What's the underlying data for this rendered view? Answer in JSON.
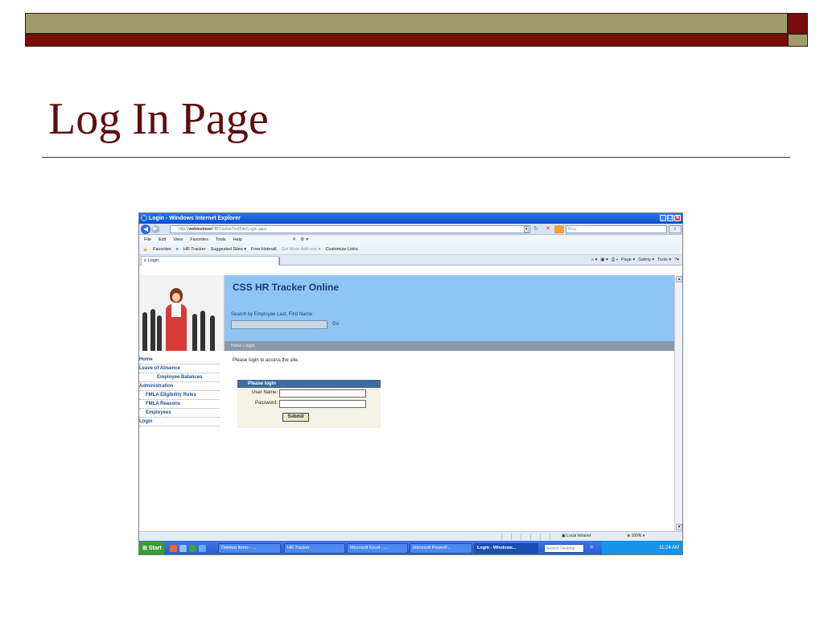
{
  "slide": {
    "title": "Log In Page"
  },
  "window": {
    "title": "Login - Windows Internet Explorer",
    "controls": [
      "_",
      "❐",
      "✕"
    ],
    "address_prefix": "http://",
    "address_host": "webtestnew",
    "address_path": "/HRTrackerTestSite/Login.aspx",
    "search_placeholder": "Bing",
    "menu": [
      "File",
      "Edit",
      "View",
      "Favorites",
      "Tools",
      "Help"
    ],
    "favorites_label": "Favorites",
    "favorites_links": [
      "HR Tracker",
      "Suggested Sites ▾",
      "Free Hotmail",
      "Get More Add-ons ▾",
      "Customize Links"
    ],
    "tab_label": "Login",
    "command_bar": [
      "Page ▾",
      "Safety ▾",
      "Tools ▾"
    ]
  },
  "site": {
    "app_title": "CSS HR Tracker Online",
    "search_label": "Search by Employee Last, First Name",
    "search_value": "",
    "go_label": "Go",
    "breadcrumb": "Home  »  login",
    "nav": [
      {
        "label": "Home",
        "level": 0
      },
      {
        "label": "Leave of Absence",
        "level": 0
      },
      {
        "label": "Employee Balances",
        "level": 1
      },
      {
        "label": "Administration",
        "level": 0
      },
      {
        "label": "FMLA Eligibility Rules",
        "level": 1
      },
      {
        "label": "FMLA Reasons",
        "level": 1
      },
      {
        "label": "Employees",
        "level": 1
      },
      {
        "label": "Login",
        "level": 0
      }
    ],
    "intro": "Please login to access the site.",
    "login": {
      "header": "Please login",
      "username_label": "User Name:",
      "username_value": "",
      "password_label": "Password:",
      "password_value": "",
      "submit_label": "Submit"
    }
  },
  "status": {
    "zone": "Local intranet",
    "zoom": "100%"
  },
  "taskbar": {
    "start_label": "Start",
    "tasks": [
      "Deleted Items - ...",
      "HR Tracker",
      "Microsoft Excel - ...",
      "Microsoft PowerP...",
      "Login - Windows..."
    ],
    "search_placeholder": "Search Desktop",
    "time": "11:24 AM"
  },
  "colors": {
    "accent_olive": "#9d9c6b",
    "accent_maroon": "#7a0c0c",
    "banner": "#8fc5f5",
    "title": "#5c0f0f"
  }
}
